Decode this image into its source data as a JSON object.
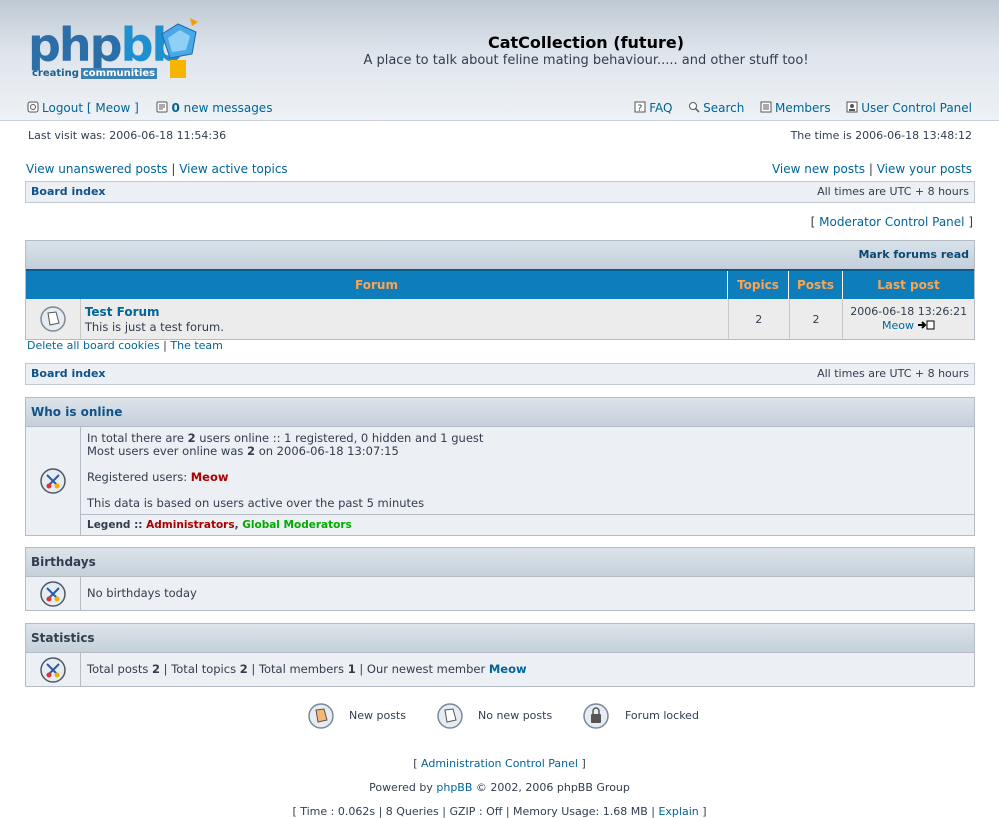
{
  "header": {
    "logo_main": "php",
    "logo_bb": "bb",
    "logo_tag1": "creating",
    "logo_tag2": "communities",
    "site_title": "CatCollection (future)",
    "site_description": "A place to talk about feline mating behaviour..... and other stuff too!",
    "logout": "Logout [ Meow ]",
    "new_messages_count": "0",
    "new_messages_label": "new messages",
    "faq": "FAQ",
    "search": "Search",
    "members": "Members",
    "ucp": "User Control Panel"
  },
  "visit": {
    "last_visit": "Last visit was: 2006-06-18 11:54:36",
    "current_time": "The time is 2006-06-18 13:48:12"
  },
  "quicklinks": {
    "unanswered": "View unanswered posts",
    "active": "View active topics",
    "new_posts": "View new posts",
    "your_posts": "View your posts"
  },
  "nav": {
    "board_index": "Board index",
    "timezone": "All times are UTC + 8 hours"
  },
  "mcp": "Moderator Control Panel",
  "forum_table": {
    "mark_read": "Mark forums read",
    "headers": [
      "Forum",
      "Topics",
      "Posts",
      "Last post"
    ],
    "rows": [
      {
        "name": "Test Forum",
        "description": "This is just a test forum.",
        "topics": "2",
        "posts": "2",
        "last_post_time": "2006-06-18 13:26:21",
        "last_post_user": "Meow"
      }
    ]
  },
  "below_links": {
    "delete_cookies": "Delete all board cookies",
    "team": "The team"
  },
  "whos_online": {
    "title": "Who is online",
    "line1_pre": "In total there are ",
    "line1_count": "2",
    "line1_post": " users online :: 1 registered, 0 hidden and 1 guest",
    "line2_pre": "Most users ever online was ",
    "line2_count": "2",
    "line2_post": " on 2006-06-18 13:07:15",
    "registered_label": "Registered users: ",
    "registered_user": "Meow",
    "active_note": "This data is based on users active over the past 5 minutes",
    "legend_label": "Legend :: ",
    "legend_admin": "Administrators",
    "legend_gmod": "Global Moderators",
    "colors": {
      "admin": "#aa0000",
      "gmod": "#00aa00"
    }
  },
  "birthdays": {
    "title": "Birthdays",
    "text": "No birthdays today"
  },
  "statistics": {
    "title": "Statistics",
    "posts_label": "Total posts ",
    "posts": "2",
    "topics_label": "Total topics ",
    "topics": "2",
    "members_label": "Total members ",
    "members": "1",
    "newest_label": "Our newest member ",
    "newest": "Meow"
  },
  "legend_icons": {
    "new_posts": "New posts",
    "no_new_posts": "No new posts",
    "locked": "Forum locked"
  },
  "footer": {
    "acp": "Administration Control Panel",
    "powered_pre": "Powered by ",
    "phpbb": "phpBB",
    "powered_post": " © 2002, 2006 phpBB Group",
    "debug": "[ Time : 0.062s | 8 Queries | GZIP : Off | Memory Usage: 1.68 MB | ",
    "explain": "Explain",
    "debug_end": " ]"
  }
}
